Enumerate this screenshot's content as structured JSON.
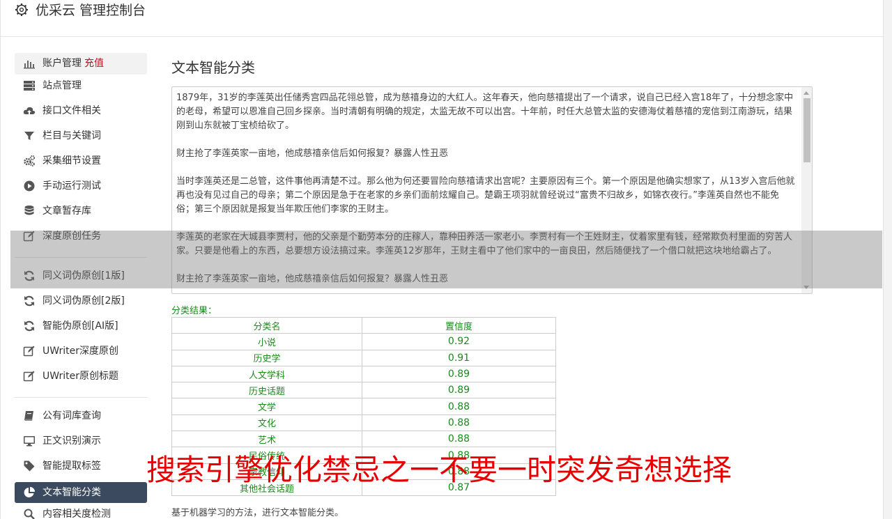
{
  "header": {
    "title": "优采云 管理控制台",
    "icon": "gear-icon"
  },
  "sidebar": {
    "group1": [
      {
        "label": "账户管理",
        "extra": "充值",
        "icon": "bar-chart-icon"
      },
      {
        "label": "站点管理",
        "icon": "server-icon"
      },
      {
        "label": "接口文件相关",
        "icon": "cloud-upload-icon"
      },
      {
        "label": "栏目与关键词",
        "icon": "filter-icon"
      },
      {
        "label": "采集细节设置",
        "icon": "gears-icon"
      },
      {
        "label": "手动运行测试",
        "icon": "play-circle-icon"
      },
      {
        "label": "文章暂存库",
        "icon": "database-icon"
      },
      {
        "label": "深度原创任务",
        "icon": "edit-icon"
      }
    ],
    "group2": [
      {
        "label": "同义词伪原创[1版]",
        "icon": "refresh-icon"
      },
      {
        "label": "同义词伪原创[2版]",
        "icon": "refresh-icon"
      },
      {
        "label": "智能伪原创[AI版]",
        "icon": "refresh-icon"
      },
      {
        "label": "UWriter深度原创",
        "icon": "edit-icon"
      },
      {
        "label": "UWriter原创标题",
        "icon": "edit-icon"
      }
    ],
    "group3": [
      {
        "label": "公有词库查询",
        "icon": "book-icon"
      },
      {
        "label": "正文识别演示",
        "icon": "desktop-icon"
      },
      {
        "label": "智能提取标签",
        "icon": "tag-icon"
      },
      {
        "label": "文本智能分类",
        "icon": "pie-chart-icon"
      },
      {
        "label": "内容相关度检测",
        "icon": "search-icon"
      }
    ]
  },
  "main": {
    "title": "文本智能分类",
    "text_paragraphs": [
      "1879年，31岁的李莲英出任储秀宫四品花翎总管，成为慈禧身边的大红人。这年春天，他向慈禧提出了一个请求，说自己已经入宫18年了，十分想念家中的老母，希望可以恩准自己回乡探亲。当时清朝有明确的规定，太监无故不可以出宫。十年前，时任大总管太监的安德海仗着慈禧的宠信到江南游玩，结果刚到山东就被丁宝桢给砍了。",
      "财主抢了李莲英家一亩地，他成慈禧亲信后如何报复？暴露人性丑恶",
      "当时李莲英还是二总管，这件事他再清楚不过。那么他为何还要冒险向慈禧请求出宫呢？主要原因有三个。第一个原因是他确实想家了，从13岁入宫后他就再也没有见过自己的母亲；第二个原因是急于在老家的乡亲们面前炫耀自己。楚霸王项羽就曾经说过“富贵不归故乡，如锦衣夜行。”李莲英自然也不能免俗；第三个原因就是报复当年欺压他们李家的王财主。",
      "李莲英的老家在大城县李贾村，他的父亲是个勤劳本分的庄稼人，靠种田养活一家老小。李贾村有一个王姓财主，仗着家里有钱，经常欺负村里面的穷苦人家。只要是他看上的东西，总要想方设法搞过来。李莲英12岁那年，王财主看中了他们家中的一亩良田，然后随便找了一个借口就把这块地给霸占了。",
      "财主抢了李莲英家一亩地，他成慈禧亲信后如何报复？暴露人性丑恶"
    ],
    "result_label": "分类结果：",
    "table": {
      "headers": [
        "分类名",
        "置信度"
      ],
      "rows": [
        [
          "小说",
          "0.92"
        ],
        [
          "历史学",
          "0.91"
        ],
        [
          "人文学科",
          "0.89"
        ],
        [
          "历史话题",
          "0.89"
        ],
        [
          "文学",
          "0.88"
        ],
        [
          "文化",
          "0.88"
        ],
        [
          "艺术",
          "0.88"
        ],
        [
          "民俗传统",
          "0.88"
        ],
        [
          "宗教信仰",
          "0.88"
        ],
        [
          "其他社会话题",
          "0.87"
        ]
      ]
    },
    "footer_note": "基于机器学习的方法，进行文本智能分类。"
  },
  "overlay_caption": "搜索引擎优化禁忌之一不要一时突发奇想选择",
  "colors": {
    "active_bg": "#3b4a5e",
    "result_green": "#1a8a1a",
    "recharge_red": "#d9001b",
    "caption_red": "#e60000"
  }
}
